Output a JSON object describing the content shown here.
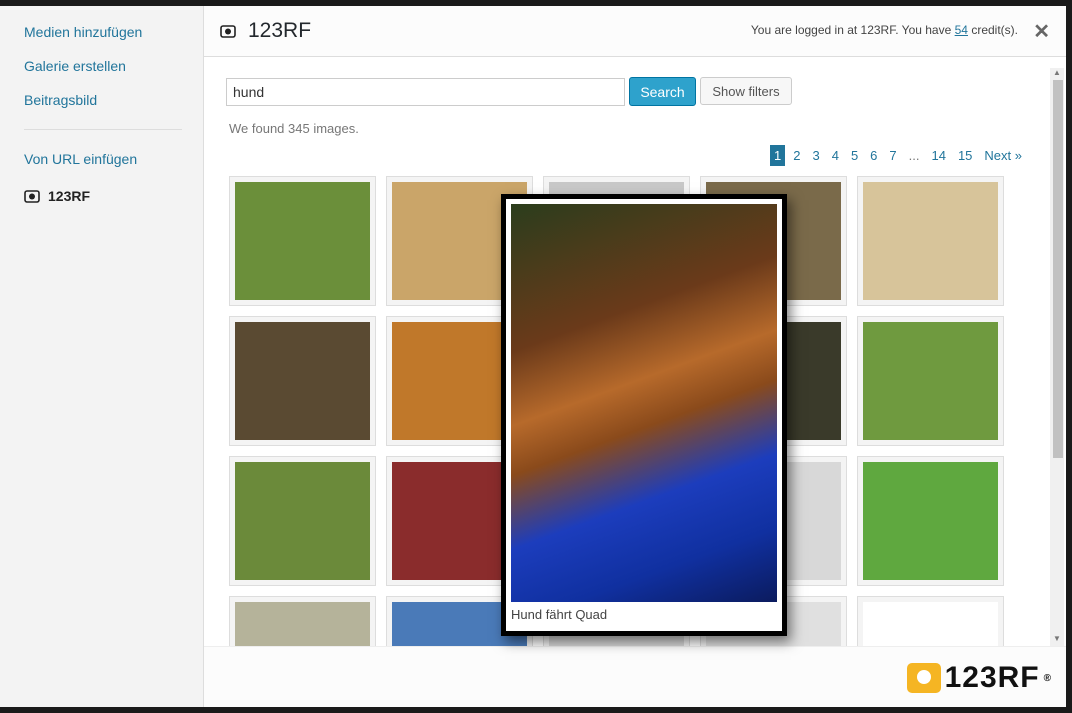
{
  "sidebar": {
    "items": [
      {
        "label": "Medien hinzufügen"
      },
      {
        "label": "Galerie erstellen"
      },
      {
        "label": "Beitragsbild"
      },
      {
        "label": "Von URL einfügen"
      }
    ],
    "active_label": "123RF",
    "active_icon": "camera-icon"
  },
  "header": {
    "title": "123RF",
    "title_icon": "camera-icon",
    "login_prefix": "You are logged in at 123RF. You have ",
    "credits": "54",
    "login_suffix": " credit(s).",
    "close_icon": "close-icon"
  },
  "search": {
    "value": "hund",
    "button_label": "Search",
    "filters_label": "Show filters",
    "result_text": "We found 345 images."
  },
  "pagination": {
    "pages": [
      "1",
      "2",
      "3",
      "4",
      "5",
      "6",
      "7",
      "...",
      "14",
      "15"
    ],
    "active": "1",
    "next_label": "Next »"
  },
  "grid": {
    "colors": [
      [
        "#6b8f3a",
        "#caa569",
        "#c8c8c8",
        "#7a6a4a",
        "#d7c49a"
      ],
      [
        "#5a4a32",
        "#c0782a",
        "#cfcfcf",
        "#3a3a2a",
        "#6f9a3f"
      ],
      [
        "#6b8a3a",
        "#8a2c2c",
        "#e2e2e2",
        "#d8d8d8",
        "#5fa83f"
      ],
      [
        "#b5b39a",
        "#4a7ab8",
        "#d9d9d9",
        "#e0e0e0",
        "#ffffff"
      ]
    ]
  },
  "preview": {
    "caption": "Hund fährt Quad"
  },
  "footer": {
    "logo_text": "123RF",
    "logo_reg": "®",
    "logo_color": "#f5b523"
  }
}
